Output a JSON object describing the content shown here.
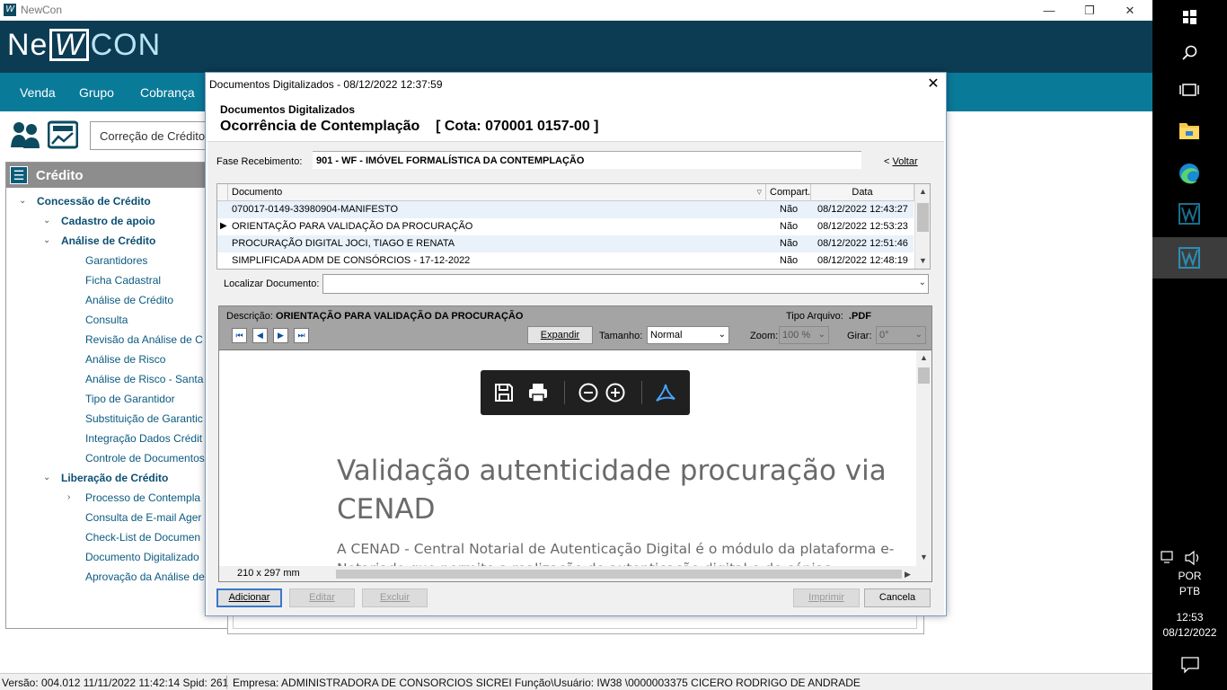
{
  "window": {
    "title": "NewCon",
    "minimize": "—",
    "restore": "❐",
    "close": "✕"
  },
  "brand": {
    "logo_part1": "Ne",
    "logo_part2": "W",
    "logo_part3": "CON"
  },
  "menu": {
    "items": [
      "Venda",
      "Grupo",
      "Cobrança"
    ]
  },
  "toolbar": {
    "field_value": "Correção de Crédito"
  },
  "sidebar": {
    "title": "Crédito",
    "tree": [
      {
        "label": "Concessão de Crédito",
        "level": 1,
        "arrow": "expanded"
      },
      {
        "label": "Cadastro de apoio",
        "level": 2,
        "arrow": "expanded"
      },
      {
        "label": "Análise de Crédito",
        "level": 2,
        "arrow": "expanded"
      },
      {
        "label": "Garantidores",
        "level": 3
      },
      {
        "label": "Ficha Cadastral",
        "level": 3
      },
      {
        "label": "Análise de Crédito",
        "level": 3
      },
      {
        "label": "Consulta",
        "level": 3
      },
      {
        "label": "Revisão da Análise de C",
        "level": 3
      },
      {
        "label": "Análise de Risco",
        "level": 3
      },
      {
        "label": "Análise de Risco - Santa",
        "level": 3
      },
      {
        "label": "Tipo de Garantidor",
        "level": 3
      },
      {
        "label": "Substituição de Garantic",
        "level": 3
      },
      {
        "label": "Integração Dados Crédit",
        "level": 3
      },
      {
        "label": "Controle de Documentos",
        "level": 3
      },
      {
        "label": "Liberação de Crédito",
        "level": 2,
        "arrow": "expanded"
      },
      {
        "label": "Processo de Contempla",
        "level": 3,
        "arrow": "collapsed"
      },
      {
        "label": "Consulta de E-mail Ager",
        "level": 3
      },
      {
        "label": "Check-List de Documen",
        "level": 3
      },
      {
        "label": "Documento Digitalizado",
        "level": 3
      },
      {
        "label": "Aprovação da Análise de",
        "level": 3
      }
    ]
  },
  "status": {
    "version": "Versão: 004.012  11/11/2022 11:42:14  Spid: 261",
    "empresa": "Empresa: ADMINISTRADORA DE CONSORCIOS SICREI Função\\Usuário: IW38  \\0000003375 CICERO RODRIGO DE ANDRADE"
  },
  "dialog": {
    "title": "Documentos Digitalizados - 08/12/2022  12:37:59",
    "close": "✕",
    "subtitle": "Documentos Digitalizados",
    "heading": "Ocorrência de Contemplação    [ Cota: 070001 0157-00 ]",
    "fase_label": "Fase Recebimento:",
    "fase_value": "901 - WF - IMÓVEL FORMALÍSTICA DA CONTEMPLAÇÃO",
    "voltar_prefix": "< ",
    "voltar_label": "Voltar",
    "grid": {
      "columns": [
        "Documento",
        "Compart.",
        "Data"
      ],
      "filter_icon": "▿",
      "rows": [
        {
          "documento": "070017-0149-33980904-MANIFESTO",
          "compart": "Não",
          "data": "08/12/2022 12:43:27",
          "selected": false
        },
        {
          "documento": "ORIENTAÇÃO PARA VALIDAÇÃO DA PROCURAÇÃO",
          "compart": "Não",
          "data": "08/12/2022 12:53:23",
          "selected": true
        },
        {
          "documento": "PROCURAÇÃO DIGITAL JOCI, TIAGO E RENATA",
          "compart": "Não",
          "data": "08/12/2022 12:51:46",
          "selected": false
        },
        {
          "documento": "SIMPLIFICADA ADM DE CONSÓRCIOS - 17-12-2022",
          "compart": "Não",
          "data": "08/12/2022 12:48:19",
          "selected": false
        }
      ]
    },
    "localizar_label": "Localizar Documento:",
    "localizar_value": "",
    "viewer": {
      "descricao_label": "Descrição:",
      "descricao_value": "ORIENTAÇÃO PARA VALIDAÇÃO DA PROCURAÇÃO",
      "tipo_label": "Tipo Arquivo:",
      "tipo_value": ".PDF",
      "expandir": "Expandir",
      "tamanho_label": "Tamanho:",
      "tamanho_value": "Normal",
      "zoom_label": "Zoom:",
      "zoom_value": "100 %",
      "girar_label": "Girar:",
      "girar_value": "0°",
      "nav": [
        "⏮",
        "◀",
        "▶",
        "⏭"
      ],
      "pdf_title_line1": "Validação autenticidade procuração via",
      "pdf_title_line2": "CENAD",
      "pdf_body_line1": "A CENAD - Central Notarial de Autenticação Digital é o módulo da plataforma e-",
      "pdf_body_line2": "Notariado que permite a realização de autenticação digital e de cópias",
      "page_size": "210 x 297 mm"
    },
    "buttons": {
      "adicionar": "Adicionar",
      "editar": "Editar",
      "excluir": "Excluir",
      "imprimir": "Imprimir",
      "cancela": "Cancela"
    }
  },
  "taskbar": {
    "lang1": "POR",
    "lang2": "PTB",
    "time": "12:53",
    "date": "08/12/2022"
  }
}
